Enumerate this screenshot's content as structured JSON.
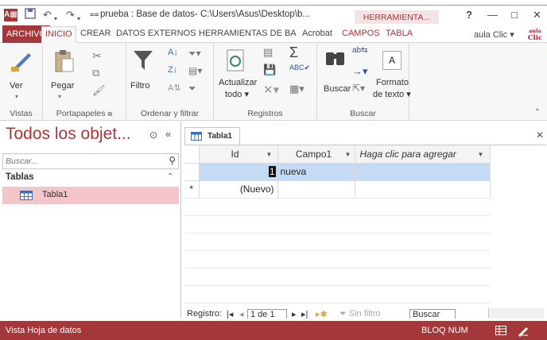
{
  "titlebar": {
    "app_badge": "A▦",
    "title": "prueba : Base de datos- C:\\Users\\Asus\\Desktop\\b...",
    "context_tab_title": "HERRAMIENTA...",
    "help": "?",
    "minimize": "—",
    "maximize": "□",
    "close": "✕"
  },
  "tabs": {
    "archivo": "ARCHIVO",
    "inicio": "INICIO",
    "crear": "CREAR",
    "datos_externos": "DATOS EXTERNOS",
    "herramientas": "HERRAMIENTAS DE BA",
    "acrobat": "Acrobat",
    "campos": "CAMPOS",
    "tabla": "TABLA",
    "user": "aula Clic",
    "logo": "aula Clic"
  },
  "ribbon": {
    "vistas": {
      "ver": "Ver",
      "label": "Vistas"
    },
    "portapapeles": {
      "pegar": "Pegar",
      "label": "Portapapeles"
    },
    "ordenar": {
      "filtro": "Filtro",
      "label": "Ordenar y filtrar"
    },
    "registros": {
      "actualizar_1": "Actualizar",
      "actualizar_2": "todo",
      "label": "Registros"
    },
    "buscar": {
      "buscar": "Buscar",
      "formato_1": "Formato",
      "formato_2": "de texto",
      "label": "Buscar"
    }
  },
  "nav": {
    "title": "Todos los objet...",
    "search_placeholder": "Buscar...",
    "group": "Tablas",
    "items": [
      {
        "label": "Tabla1"
      }
    ]
  },
  "document": {
    "tab": "Tabla1",
    "columns": [
      "Id",
      "Campo1",
      "Haga clic para agregar"
    ],
    "rows": [
      {
        "selector": "",
        "id": "1",
        "campo1": "nueva"
      },
      {
        "selector": "*",
        "id": "(Nuevo)",
        "campo1": ""
      }
    ]
  },
  "record_nav": {
    "label": "Registro:",
    "current": "1 de 1",
    "filter": "Sin filtro",
    "search": "Buscar"
  },
  "status": {
    "view": "Vista Hoja de datos",
    "numlock": "BLOQ NUM"
  },
  "colors": {
    "accent": "#a4373a",
    "selection": "#c5dbf3",
    "nav_selection": "#f5c6c9"
  }
}
